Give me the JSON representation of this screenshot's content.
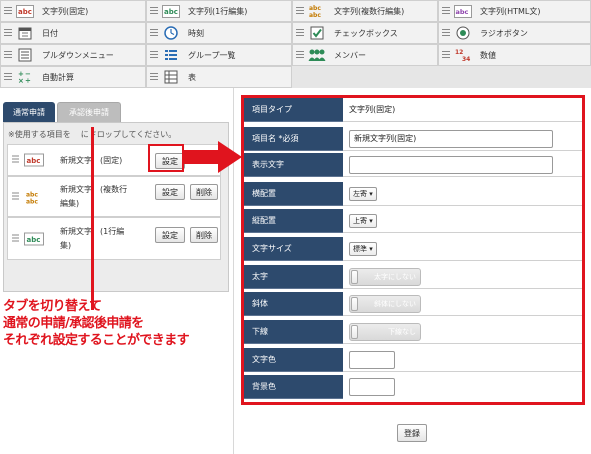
{
  "palette": {
    "items": [
      {
        "label": "文字列(固定)",
        "icon": "abc-text-icon"
      },
      {
        "label": "文字列(1行編集)",
        "icon": "abc-text-icon"
      },
      {
        "label": "文字列(複数行編集)",
        "icon": "abc-multiline-icon"
      },
      {
        "label": "文字列(HTML文)",
        "icon": "html-text-icon"
      },
      {
        "label": "日付",
        "icon": "calendar-icon"
      },
      {
        "label": "時刻",
        "icon": "clock-icon"
      },
      {
        "label": "チェックボックス",
        "icon": "checkbox-icon"
      },
      {
        "label": "ラジオボタン",
        "icon": "radio-icon"
      },
      {
        "label": "プルダウンメニュー",
        "icon": "dropdown-icon"
      },
      {
        "label": "グループ一覧",
        "icon": "group-list-icon"
      },
      {
        "label": "メンバー",
        "icon": "members-icon"
      },
      {
        "label": "数値",
        "icon": "number-icon"
      },
      {
        "label": "自動計算",
        "icon": "calculator-icon"
      },
      {
        "label": "表",
        "icon": "table-icon"
      }
    ]
  },
  "tabs": {
    "normal": "通常申請",
    "approval": "承認後申請"
  },
  "left_panel": {
    "note": "※使用する項目を",
    "note_tail": "にドロップしてください。",
    "rows": [
      {
        "name_a": "新規文字",
        "name_b": "(固定)",
        "name_c": ""
      },
      {
        "name_a": "新規文字",
        "name_b": "(複数行",
        "name_c": "編集)"
      },
      {
        "name_a": "新規文字",
        "name_b": "(1行編",
        "name_c": "集)"
      }
    ],
    "settings_label": "設定",
    "delete_label": "削除"
  },
  "form": {
    "rows": {
      "item_type": {
        "label": "項目タイプ",
        "value": "文字列(固定)"
      },
      "item_name": {
        "label": "項目名",
        "required": "*必須",
        "value": "新規文字列(固定)"
      },
      "display_text": {
        "label": "表示文字",
        "value": ""
      },
      "h_align": {
        "label": "横配置",
        "value": "左寄 ▾"
      },
      "v_align": {
        "label": "縦配置",
        "value": "上寄 ▾"
      },
      "font_size": {
        "label": "文字サイズ",
        "value": "標準 ▾"
      },
      "bold": {
        "label": "太字",
        "value": "太字にしない"
      },
      "italic": {
        "label": "斜体",
        "value": "斜体にしない"
      },
      "underline": {
        "label": "下線",
        "value": "下線なし"
      },
      "text_color": {
        "label": "文字色",
        "value": ""
      },
      "bg_color": {
        "label": "背景色",
        "value": ""
      }
    },
    "register_label": "登録"
  },
  "annotation": {
    "line1": "タブを切り替えて",
    "line2": "通常の申請/承認後申請を",
    "line3": "それぞれ設定することができます"
  },
  "colors": {
    "accent_red": "#e0141e",
    "label_navy": "#2d4a6d"
  }
}
